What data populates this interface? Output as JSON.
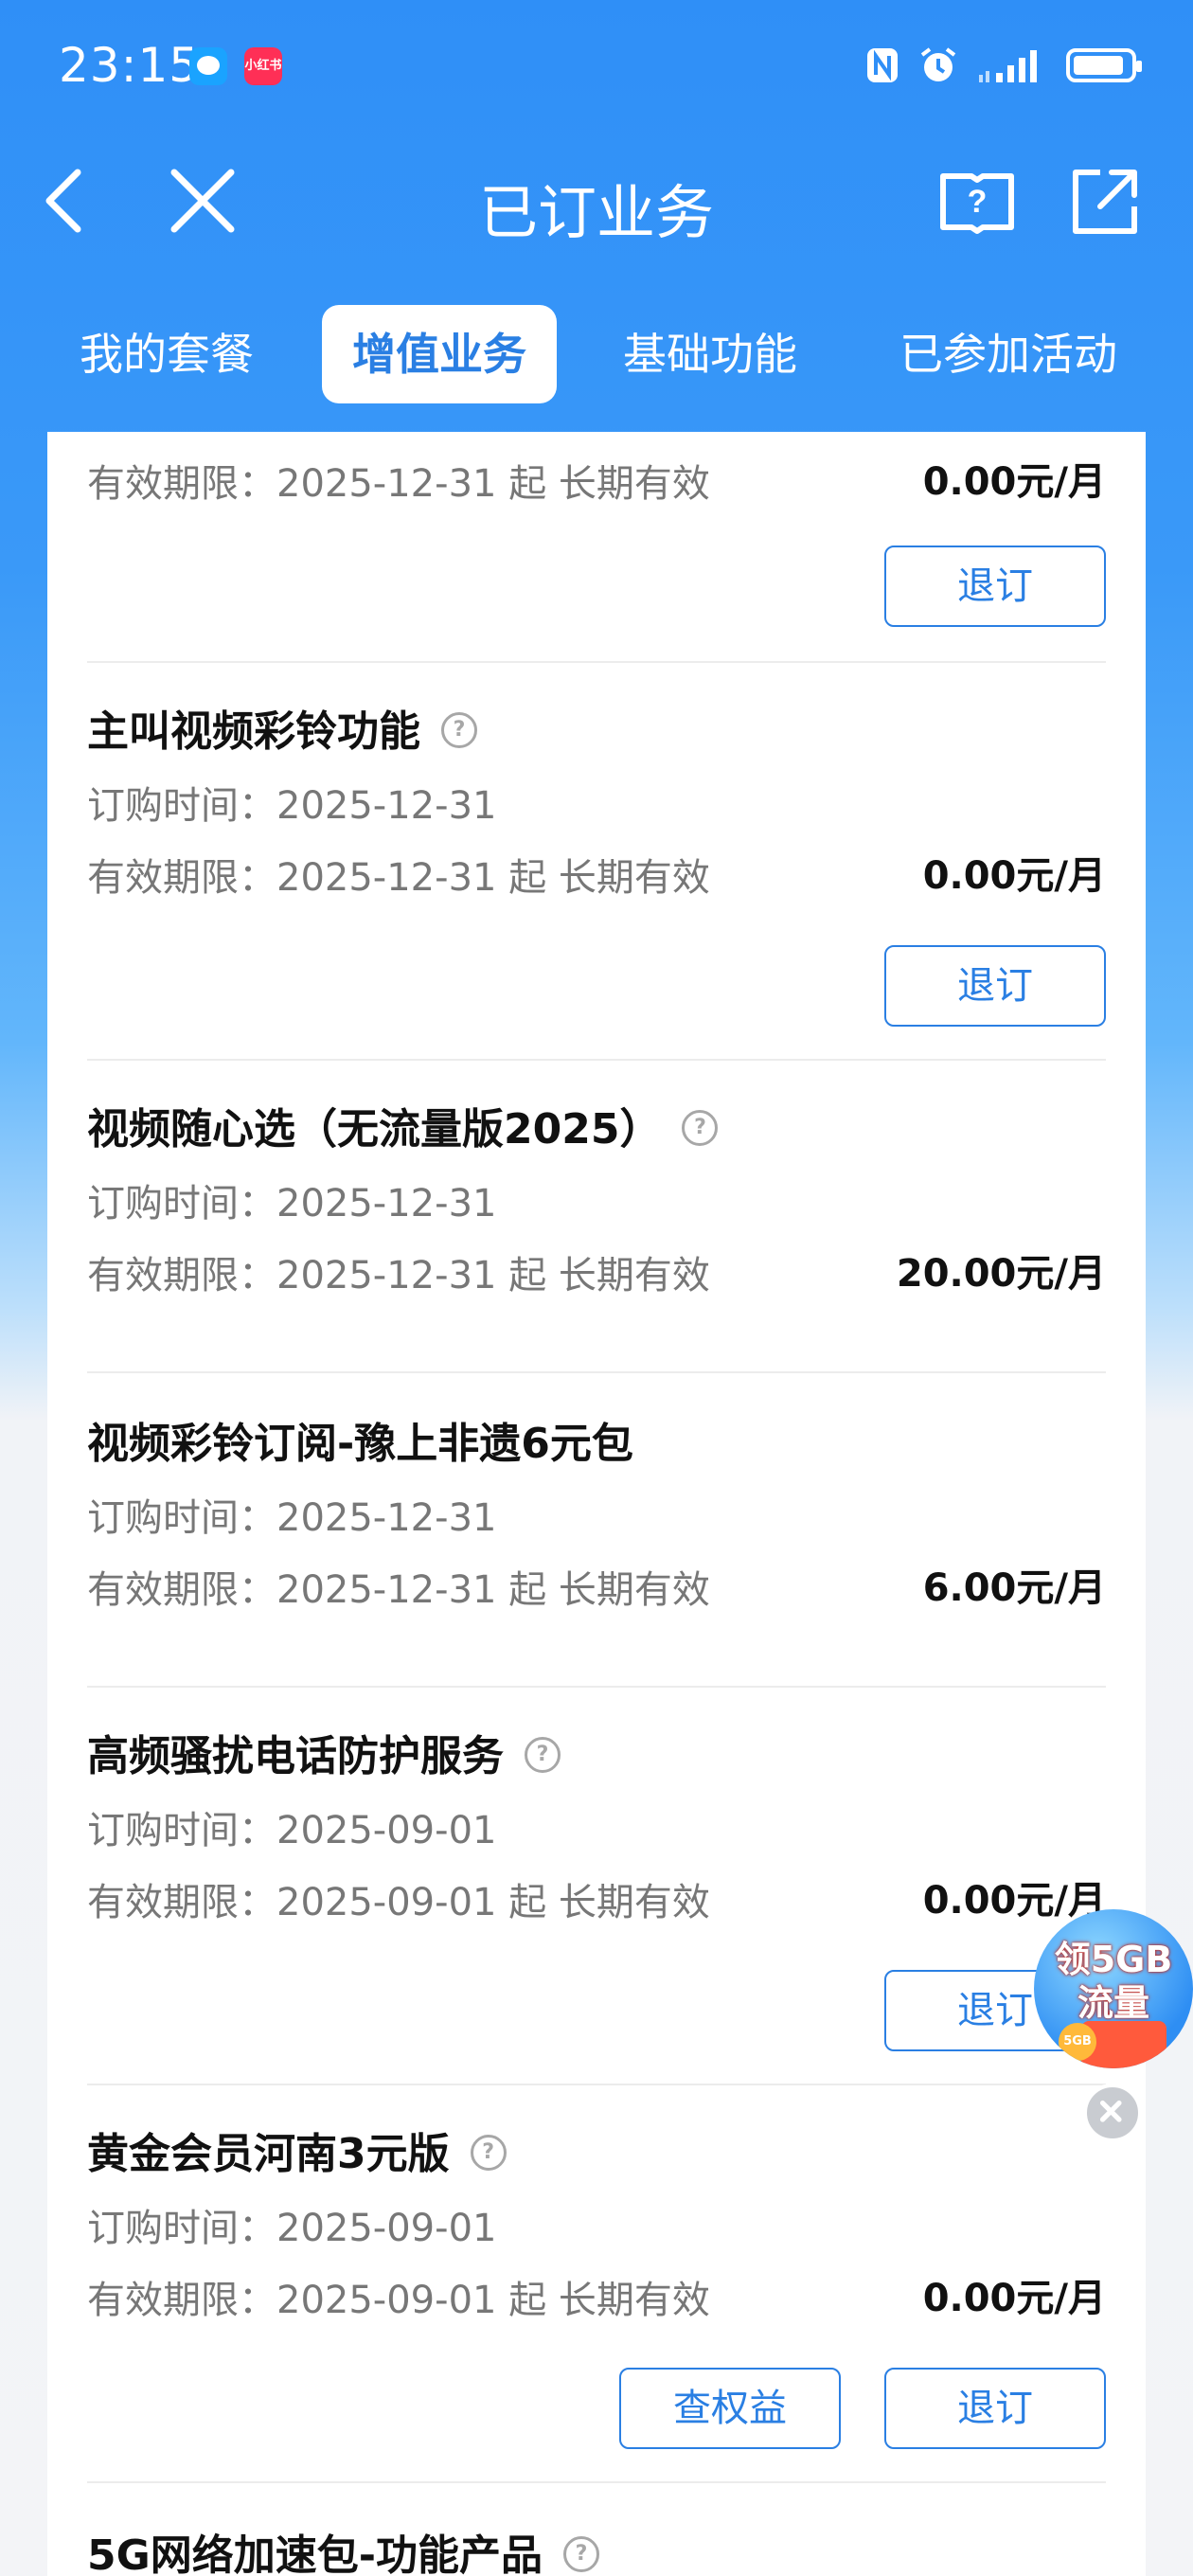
{
  "status_bar": {
    "time": "23:15",
    "app_badge_label": "小红书"
  },
  "header": {
    "title": "已订业务"
  },
  "tabs": [
    {
      "label": "我的套餐"
    },
    {
      "label": "增值业务"
    },
    {
      "label": "基础功能"
    },
    {
      "label": "已参加活动"
    }
  ],
  "labels": {
    "order_time": "订购时间：",
    "valid_period": "有效期限：",
    "valid_suffix": "起 长期有效",
    "unsubscribe": "退订",
    "view_rights": "查权益"
  },
  "items": [
    {
      "name": "",
      "validity": "2025-12-31",
      "price": "0.00元/月"
    },
    {
      "name": "主叫视频彩铃功能",
      "order_time": "2025-12-31",
      "validity": "2025-12-31",
      "price": "0.00元/月"
    },
    {
      "name": "视频随心选（无流量版2025）",
      "order_time": "2025-12-31",
      "validity": "2025-12-31",
      "price": "20.00元/月"
    },
    {
      "name": "视频彩铃订阅-豫上非遗6元包",
      "order_time": "2025-12-31",
      "validity": "2025-12-31",
      "price": "6.00元/月"
    },
    {
      "name": "高频骚扰电话防护服务",
      "order_time": "2025-09-01",
      "validity": "2025-09-01",
      "price": "0.00元/月"
    },
    {
      "name": "黄金会员河南3元版",
      "order_time": "2025-09-01",
      "validity": "2025-09-01",
      "price": "0.00元/月"
    },
    {
      "name": "5G网络加速包-功能产品"
    }
  ],
  "promo": {
    "line1": "领5GB",
    "line2": "流量",
    "coin_label": "5GB"
  },
  "colors": {
    "primary": "#2a7fe3",
    "header_bg": "#2f8ff7"
  },
  "icons": [
    "back-icon",
    "close-icon",
    "help-book-icon",
    "share-icon",
    "question-circle-icon",
    "nfc-icon",
    "alarm-icon",
    "signal-icon",
    "battery-icon"
  ]
}
